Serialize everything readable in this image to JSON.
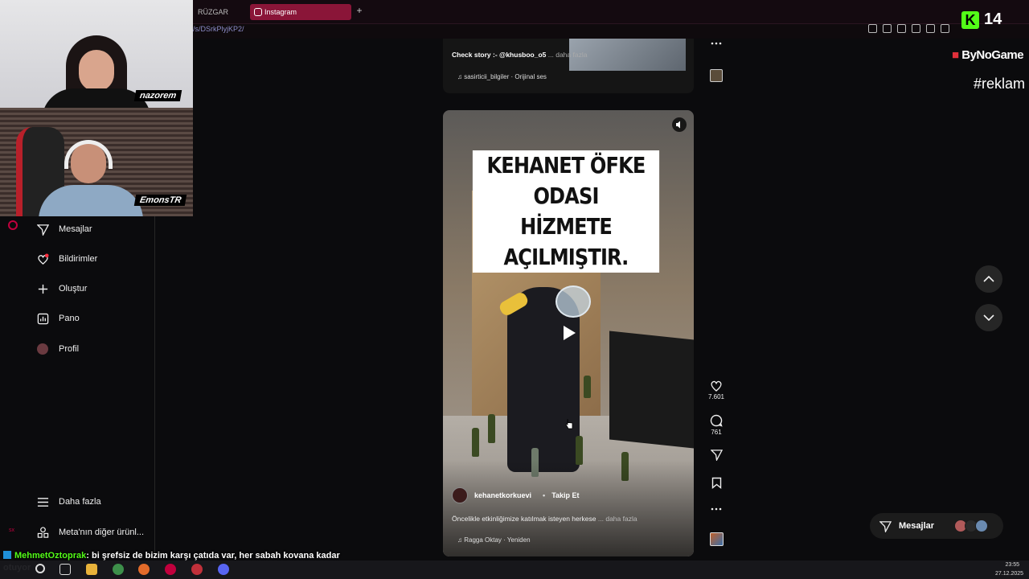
{
  "browser": {
    "tabs": [
      {
        "label": "RÜZGAR TÜRBİN",
        "active": false
      },
      {
        "label": "Instagram",
        "active": true
      }
    ],
    "url": "/s/DSrkPlyjKP2/"
  },
  "overlay": {
    "kick_count": "14",
    "brand": "ByNoGame",
    "hashtag": "#reklam",
    "cam_names": [
      "nazorem",
      "EmonsTR"
    ]
  },
  "sidebar": {
    "items": [
      {
        "label": "Mesajlar",
        "icon": "send-icon"
      },
      {
        "label": "Bildirimler",
        "icon": "heart-icon"
      },
      {
        "label": "Oluştur",
        "icon": "plus-icon"
      },
      {
        "label": "Pano",
        "icon": "dashboard-icon"
      },
      {
        "label": "Profil",
        "icon": "avatar-icon"
      }
    ],
    "bottom_items": [
      {
        "label": "Daha fazla",
        "icon": "menu-icon"
      },
      {
        "label": "Meta'nın diğer ürünl...",
        "icon": "meta-apps-icon"
      }
    ]
  },
  "previous_post": {
    "caption": "Check story :- @khusboo_o5",
    "more": "... daha fazla",
    "audio": "sasirticii_bilgiler · Orijinal ses"
  },
  "reel": {
    "headline_line1": "KEHANET ÖFKE ODASI",
    "headline_line2": "HİZMETE AÇILMIŞTIR.",
    "author": "kehanetkorkuevi",
    "follow": "Takip Et",
    "caption": "Öncelikle etkinliğimize katılmak isteyen herkese",
    "more": "... daha fazla",
    "audio": "Ragga Oktay · Yeniden"
  },
  "actions": {
    "likes": "7.601",
    "comments": "761"
  },
  "messages_pill": {
    "label": "Mesajlar"
  },
  "chat": {
    "user": "MehmetOztoprak",
    "message": ": bi şrefsiz de bizim karşı çatıda var, her sabah kovana kadar otuyor"
  },
  "taskbar": {
    "time": "23:55",
    "date": "27.12.2025"
  },
  "colors": {
    "instagram_accent": "#c1003d",
    "kick_green": "#53fc18",
    "active_tab": "#8a1538"
  }
}
